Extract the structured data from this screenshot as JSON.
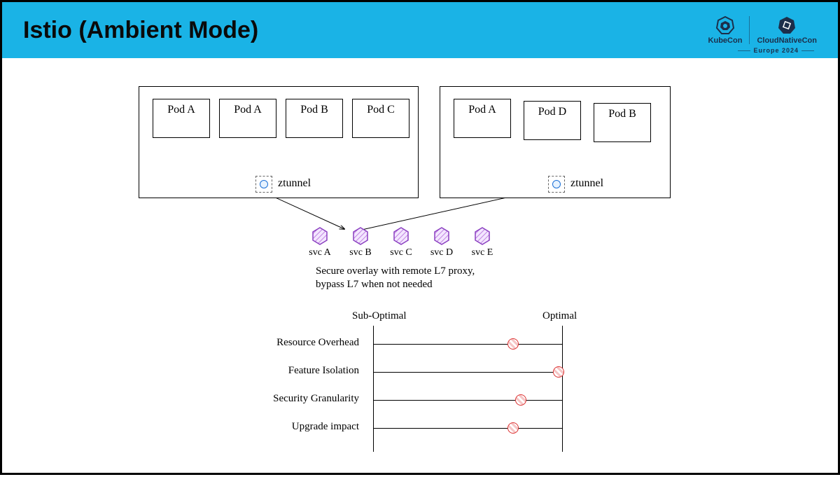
{
  "title": "Istio (Ambient Mode)",
  "logos": {
    "kubecon": "KubeCon",
    "cloudnative": "CloudNativeCon",
    "europe": "Europe 2024"
  },
  "nodes": {
    "left": {
      "pods": [
        "Pod A",
        "Pod A",
        "Pod B",
        "Pod C"
      ],
      "ztunnel": "ztunnel"
    },
    "right": {
      "pods": [
        "Pod A",
        "Pod D",
        "Pod B"
      ],
      "ztunnel": "ztunnel"
    }
  },
  "services": [
    "svc A",
    "svc B",
    "svc C",
    "svc D",
    "svc E"
  ],
  "description_line1": "Secure overlay with remote L7 proxy,",
  "description_line2": "bypass L7 when not needed",
  "scale": {
    "left_label": "Sub-Optimal",
    "right_label": "Optimal",
    "metrics": [
      {
        "label": "Resource Overhead",
        "value": 0.74
      },
      {
        "label": "Feature Isolation",
        "value": 0.98
      },
      {
        "label": "Security Granularity",
        "value": 0.78
      },
      {
        "label": "Upgrade impact",
        "value": 0.74
      }
    ]
  },
  "chart_data": {
    "type": "bar",
    "categories": [
      "Resource Overhead",
      "Feature Isolation",
      "Security Granularity",
      "Upgrade impact"
    ],
    "values": [
      0.74,
      0.98,
      0.78,
      0.74
    ],
    "title": "",
    "xlabel": "Sub-Optimal → Optimal",
    "ylabel": "",
    "ylim": [
      0,
      1
    ]
  }
}
